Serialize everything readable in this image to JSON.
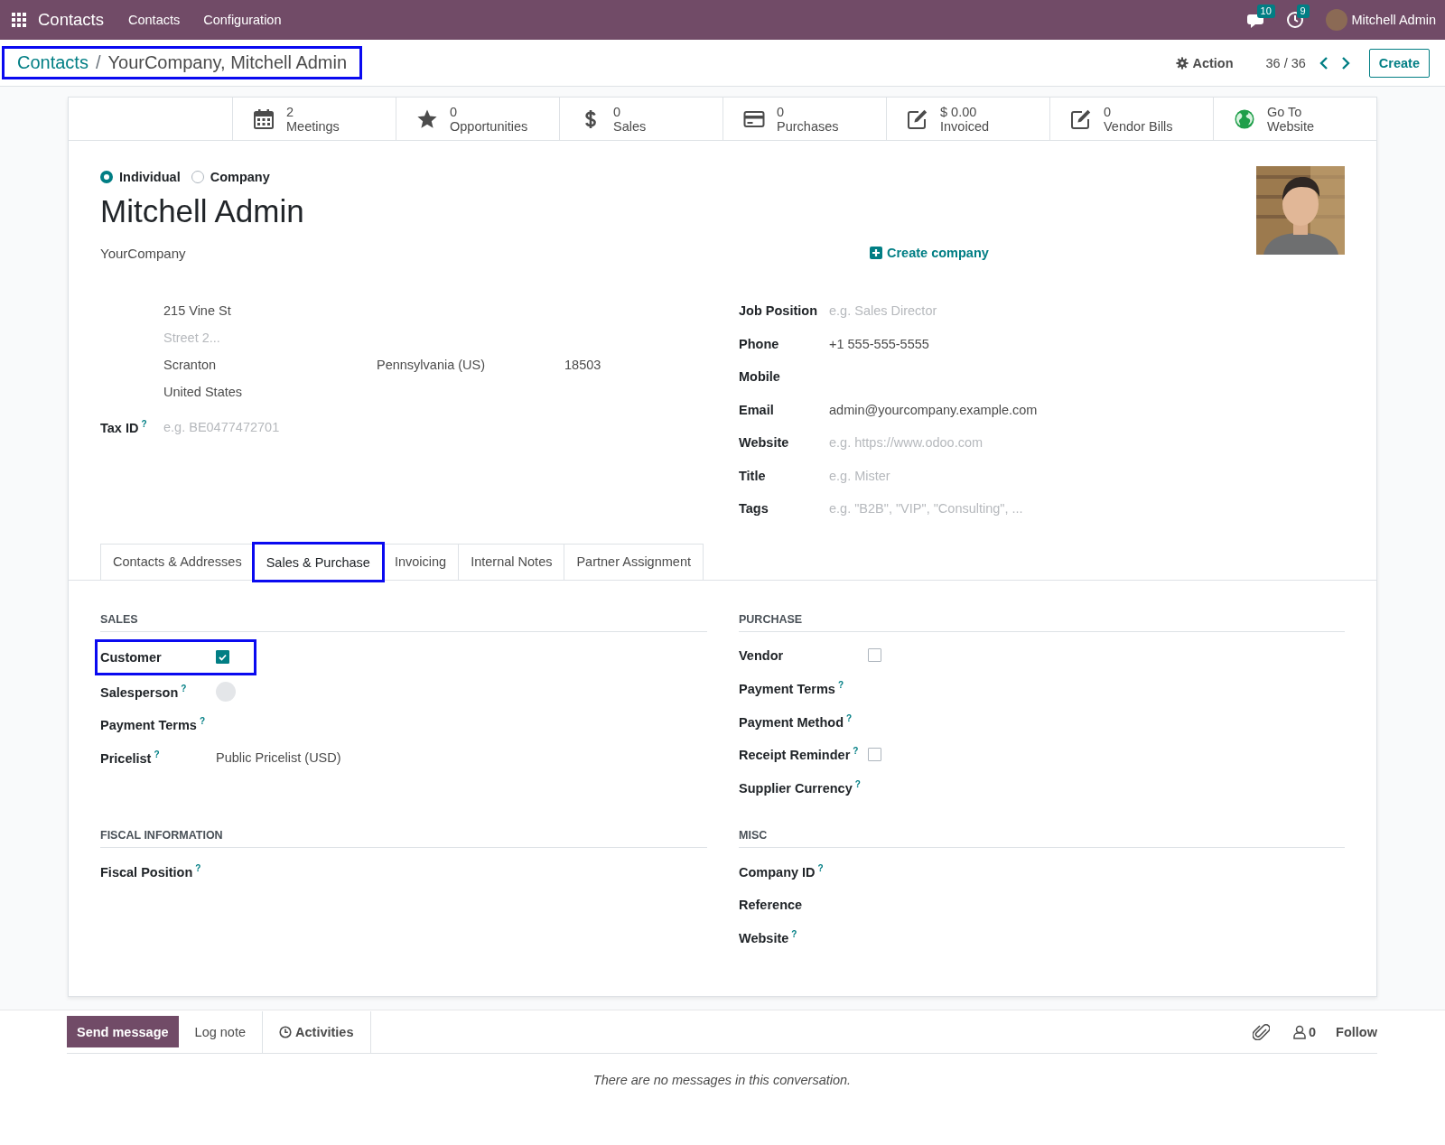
{
  "navbar": {
    "app_name": "Contacts",
    "menu": [
      "Contacts",
      "Configuration"
    ],
    "messages_count": "10",
    "activities_count": "9",
    "user_name": "Mitchell Admin"
  },
  "breadcrumb": {
    "highlighted": true,
    "items": [
      "Contacts",
      "YourCompany, Mitchell Admin"
    ],
    "separator": "/"
  },
  "control_panel": {
    "action": "Action",
    "pager": "36 / 36",
    "create": "Create"
  },
  "smart_buttons": [
    {
      "kind": "meetings",
      "value": "2",
      "label": "Meetings"
    },
    {
      "kind": "opportunities",
      "value": "0",
      "label": "Opportunities"
    },
    {
      "kind": "sales",
      "value": "0",
      "label": "Sales"
    },
    {
      "kind": "purchases",
      "value": "0",
      "label": "Purchases"
    },
    {
      "kind": "invoiced",
      "value": "$ 0.00",
      "label": "Invoiced"
    },
    {
      "kind": "vendor_bills",
      "value": "0",
      "label": "Vendor Bills"
    },
    {
      "kind": "website",
      "value": "Go To",
      "label": "Website"
    }
  ],
  "company_type": [
    {
      "label": "Individual",
      "selected": true
    },
    {
      "label": "Company",
      "selected": false
    }
  ],
  "name": "Mitchell Admin",
  "parent_company": "YourCompany",
  "create_company": "Create company",
  "address": {
    "street": "215 Vine St",
    "street2_placeholder": "Street 2...",
    "city": "Scranton",
    "state": "Pennsylvania (US)",
    "zip": "18503",
    "country": "United States"
  },
  "tax_id": {
    "label": "Tax ID",
    "help": "?",
    "placeholder": "e.g. BE0477472701"
  },
  "contact_fields": [
    {
      "label": "Job Position",
      "placeholder": "e.g. Sales Director"
    },
    {
      "label": "Phone",
      "value": "+1 555-555-5555"
    },
    {
      "label": "Mobile"
    },
    {
      "label": "Email",
      "value": "admin@yourcompany.example.com"
    },
    {
      "label": "Website",
      "placeholder": "e.g. https://www.odoo.com"
    },
    {
      "label": "Title",
      "placeholder": "e.g. Mister"
    },
    {
      "label": "Tags",
      "placeholder": "e.g. \"B2B\", \"VIP\", \"Consulting\", ..."
    }
  ],
  "tabs": [
    {
      "label": "Contacts & Addresses",
      "selected": false,
      "highlighted": false
    },
    {
      "label": "Sales & Purchase",
      "selected": true,
      "highlighted": true
    },
    {
      "label": "Invoicing",
      "selected": false,
      "highlighted": false
    },
    {
      "label": "Internal Notes",
      "selected": false,
      "highlighted": false
    },
    {
      "label": "Partner Assignment",
      "selected": false,
      "highlighted": false
    }
  ],
  "sections": [
    {
      "title": "SALES",
      "fields": [
        {
          "label": "Customer",
          "kind": "checkbox",
          "checked": true,
          "highlighted": true
        },
        {
          "label": "Salesperson",
          "help": "?",
          "kind": "avatar",
          "highlighted": false
        },
        {
          "label": "Payment Terms",
          "help": "?",
          "kind": "text",
          "highlighted": false
        },
        {
          "label": "Pricelist",
          "help": "?",
          "kind": "text",
          "value": "Public Pricelist (USD)",
          "highlighted": false
        }
      ]
    },
    {
      "title": "PURCHASE",
      "fields": [
        {
          "label": "Vendor",
          "kind": "checkbox",
          "checked": false,
          "highlighted": false
        },
        {
          "label": "Payment Terms",
          "help": "?",
          "kind": "text",
          "highlighted": false
        },
        {
          "label": "Payment Method",
          "help": "?",
          "kind": "text",
          "highlighted": false
        },
        {
          "label": "Receipt Reminder",
          "help": "?",
          "kind": "checkbox",
          "checked": false,
          "highlighted": false
        },
        {
          "label": "Supplier Currency",
          "help": "?",
          "kind": "text",
          "highlighted": false
        }
      ]
    },
    {
      "title": "FISCAL INFORMATION",
      "fields": [
        {
          "label": "Fiscal Position",
          "help": "?",
          "kind": "text",
          "highlighted": false
        }
      ]
    },
    {
      "title": "MISC",
      "fields": [
        {
          "label": "Company ID",
          "help": "?",
          "kind": "text",
          "highlighted": false
        },
        {
          "label": "Reference",
          "kind": "text",
          "highlighted": false
        },
        {
          "label": "Website",
          "help": "?",
          "kind": "text",
          "highlighted": false
        }
      ]
    }
  ],
  "chatter": {
    "send_message": "Send message",
    "log_note": "Log note",
    "activities": "Activities",
    "followers_count": "0",
    "follow": "Follow",
    "empty_message": "There are no messages in this conversation."
  }
}
